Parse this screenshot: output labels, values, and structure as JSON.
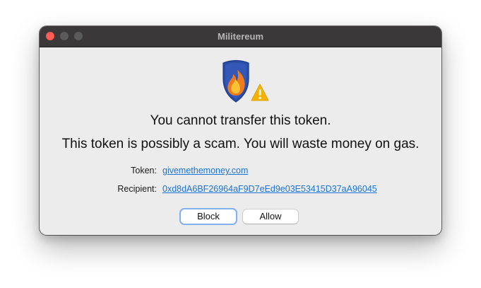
{
  "window": {
    "title": "Militereum"
  },
  "dialog": {
    "icon_name": "shield-fire-warning-icon",
    "headline": "You cannot transfer this token.",
    "subheadline": "This token is possibly a scam. You will waste money on gas.",
    "fields": [
      {
        "label": "Token:",
        "value": "givemethemoney.com"
      },
      {
        "label": "Recipient:",
        "value": "0xd8dA6BF26964aF9D7eEd9e03E53415D37aA96045"
      }
    ],
    "buttons": {
      "block": "Block",
      "allow": "Allow"
    }
  },
  "colors": {
    "link": "#1a73d9",
    "shield": "#2a4ea8",
    "flame": "#f07b1c",
    "warning": "#f5b300",
    "close_button": "#ff5f57",
    "titlebar": "#3a3838"
  }
}
